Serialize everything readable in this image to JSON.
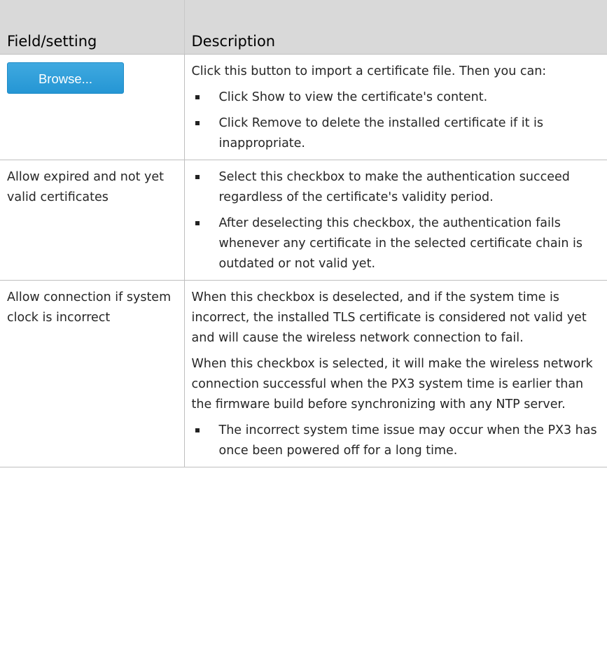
{
  "table": {
    "headers": [
      "Field/setting",
      "Description"
    ],
    "rows": [
      {
        "field_button": "Browse...",
        "intro": "Click this button to import a certificate file. Then you can:",
        "bullets": [
          "Click Show to view the certificate's content.",
          "Click Remove to delete the installed certificate if it is inappropriate."
        ]
      },
      {
        "field": "Allow expired and not yet valid certificates",
        "bullets": [
          "Select this checkbox to make the authentication succeed regardless of the certificate's validity period.",
          "After deselecting this checkbox, the authentication fails whenever any certificate in the selected certificate chain is outdated or not valid yet."
        ]
      },
      {
        "field": "Allow connection if system clock is incorrect",
        "paragraphs": [
          "When this checkbox is deselected, and if the system time is incorrect, the installed TLS certificate is considered not valid yet and will cause the wireless network connection to fail.",
          "When this checkbox is selected, it will make the wireless network connection successful when the PX3 system time is earlier than the firmware build before synchronizing with any NTP server."
        ],
        "bullets": [
          "The incorrect system time issue may occur when the PX3 has once been powered off for a long time."
        ]
      }
    ]
  },
  "colors": {
    "header_bg": "#d9d9d9",
    "button_bg": "#2596d4",
    "border": "#bfbfbf"
  }
}
